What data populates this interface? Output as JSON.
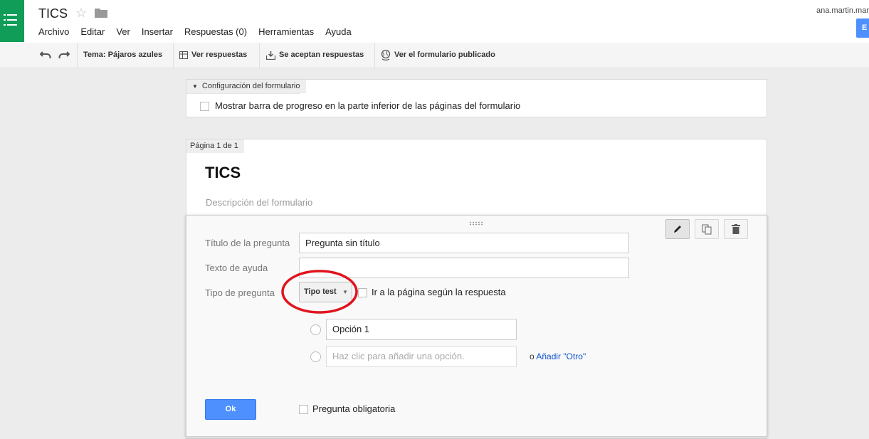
{
  "app": {
    "title": "TICS",
    "account": "ana.martin.mar",
    "edit_button": "E"
  },
  "menu": [
    "Archivo",
    "Editar",
    "Ver",
    "Insertar",
    "Respuestas (0)",
    "Herramientas",
    "Ayuda"
  ],
  "toolbar": {
    "theme": "Tema: Pájaros azules",
    "view_responses": "Ver respuestas",
    "accepting": "Se aceptan respuestas",
    "view_published": "Ver el formulario publicado"
  },
  "settings": {
    "header": "Configuración del formulario",
    "progress_bar": "Mostrar barra de progreso en la parte inferior de las páginas del formulario"
  },
  "page": {
    "label": "Página 1 de 1",
    "form_title": "TICS",
    "description_placeholder": "Descripción del formulario"
  },
  "question": {
    "title_label": "Título de la pregunta",
    "title_value": "Pregunta sin título",
    "help_label": "Texto de ayuda",
    "help_value": "",
    "type_label": "Tipo de pregunta",
    "type_value": "Tipo test",
    "go_to_page": "Ir a la página según la respuesta",
    "option1": "Opción 1",
    "add_option_placeholder": "Haz clic para añadir una opción.",
    "or": "o",
    "add_other": "Añadir \"Otro\"",
    "ok": "Ok",
    "required": "Pregunta obligatoria"
  },
  "colors": {
    "accent_green": "#0f9d58",
    "button_blue": "#4d90fe",
    "annotation_red": "#e0141e",
    "link_blue": "#1155cc"
  }
}
